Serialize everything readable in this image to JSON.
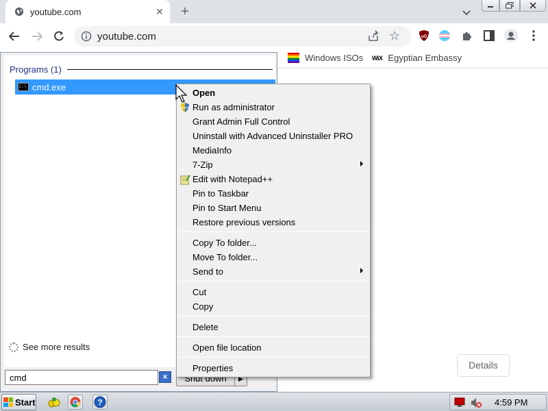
{
  "browser": {
    "tab_title": "youtube.com",
    "url": "youtube.com",
    "bookmarks": [
      {
        "label": "Windows ISOs",
        "icon": "rainbow-flag-icon"
      },
      {
        "label": "Egyptian Embassy",
        "icon": "wix-icon"
      }
    ],
    "content": {
      "details_label": "Details"
    }
  },
  "start_menu": {
    "programs_header": "Programs (1)",
    "results": [
      {
        "label": "cmd.exe",
        "icon": "cmd-icon"
      }
    ],
    "see_more": "See more results",
    "search_value": "cmd",
    "shutdown_label": "Shut down"
  },
  "context_menu": {
    "items": [
      {
        "label": "Open",
        "bold": true
      },
      {
        "label": "Run as administrator",
        "icon": "shield-icon"
      },
      {
        "label": "Grant Admin Full Control"
      },
      {
        "label": "Uninstall with Advanced Uninstaller PRO"
      },
      {
        "label": "MediaInfo"
      },
      {
        "label": "7-Zip",
        "submenu": true
      },
      {
        "label": "Edit with Notepad++",
        "icon": "notepadpp-icon"
      },
      {
        "label": "Pin to Taskbar"
      },
      {
        "label": "Pin to Start Menu"
      },
      {
        "label": "Restore previous versions"
      },
      {
        "label": "Copy To folder..."
      },
      {
        "label": "Move To folder..."
      },
      {
        "label": "Send to",
        "submenu": true
      },
      {
        "label": "Cut"
      },
      {
        "label": "Copy"
      },
      {
        "label": "Delete"
      },
      {
        "label": "Open file location"
      },
      {
        "label": "Properties"
      }
    ]
  },
  "taskbar": {
    "start_label": "Start",
    "clock": "4:59 PM"
  }
}
